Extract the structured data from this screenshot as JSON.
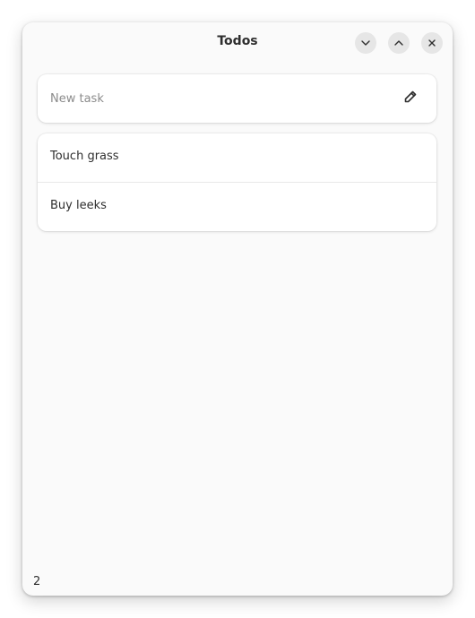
{
  "window": {
    "title": "Todos",
    "controls": {
      "minimize_icon": "chevron-down-icon",
      "maximize_icon": "chevron-up-icon",
      "close_icon": "close-icon"
    }
  },
  "entry": {
    "placeholder": "New task",
    "value": "",
    "action_icon": "pencil-icon"
  },
  "tasks": [
    {
      "label": "Touch grass"
    },
    {
      "label": "Buy leeks"
    }
  ],
  "footer": {
    "count": "2"
  }
}
